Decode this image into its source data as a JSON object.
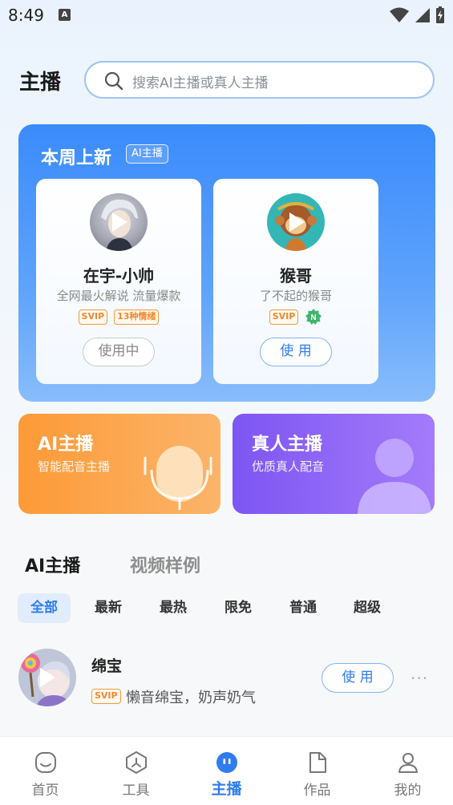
{
  "status_bar": {
    "time": "8:49",
    "notification_letter": "A"
  },
  "header": {
    "title": "主播",
    "search_placeholder": "搜索AI主播或真人主播"
  },
  "weekly": {
    "title": "本周上新",
    "badge": "AI主播",
    "cards": [
      {
        "name": "在宇-小帅",
        "desc": "全网最火解说 流量爆款",
        "tags": [
          "SVIP",
          "13种情绪"
        ],
        "button": "使用中"
      },
      {
        "name": "猴哥",
        "desc": "了不起的猴哥",
        "tags": [
          "SVIP",
          "N"
        ],
        "button": "使 用"
      }
    ]
  },
  "categories": [
    {
      "title": "AI主播",
      "subtitle": "智能配音主播",
      "color": "#fd9a37"
    },
    {
      "title": "真人主播",
      "subtitle": "优质真人配音",
      "color": "#7d55f3"
    }
  ],
  "tabs": {
    "active": "AI主播",
    "inactive": "视频样例"
  },
  "filters": [
    "全部",
    "最新",
    "最热",
    "限免",
    "普通",
    "超级"
  ],
  "list": [
    {
      "name": "绵宝",
      "tag": "SVIP",
      "desc": "懒音绵宝，奶声奶气",
      "button": "使 用",
      "more": "···"
    }
  ],
  "bottom_nav": [
    {
      "label": "首页",
      "icon": "home-icon"
    },
    {
      "label": "工具",
      "icon": "tools-icon"
    },
    {
      "label": "主播",
      "icon": "anchor-icon",
      "active": true
    },
    {
      "label": "作品",
      "icon": "works-icon"
    },
    {
      "label": "我的",
      "icon": "profile-icon"
    }
  ],
  "colors": {
    "accent": "#2f7cf0",
    "svip": "#f0892a"
  }
}
